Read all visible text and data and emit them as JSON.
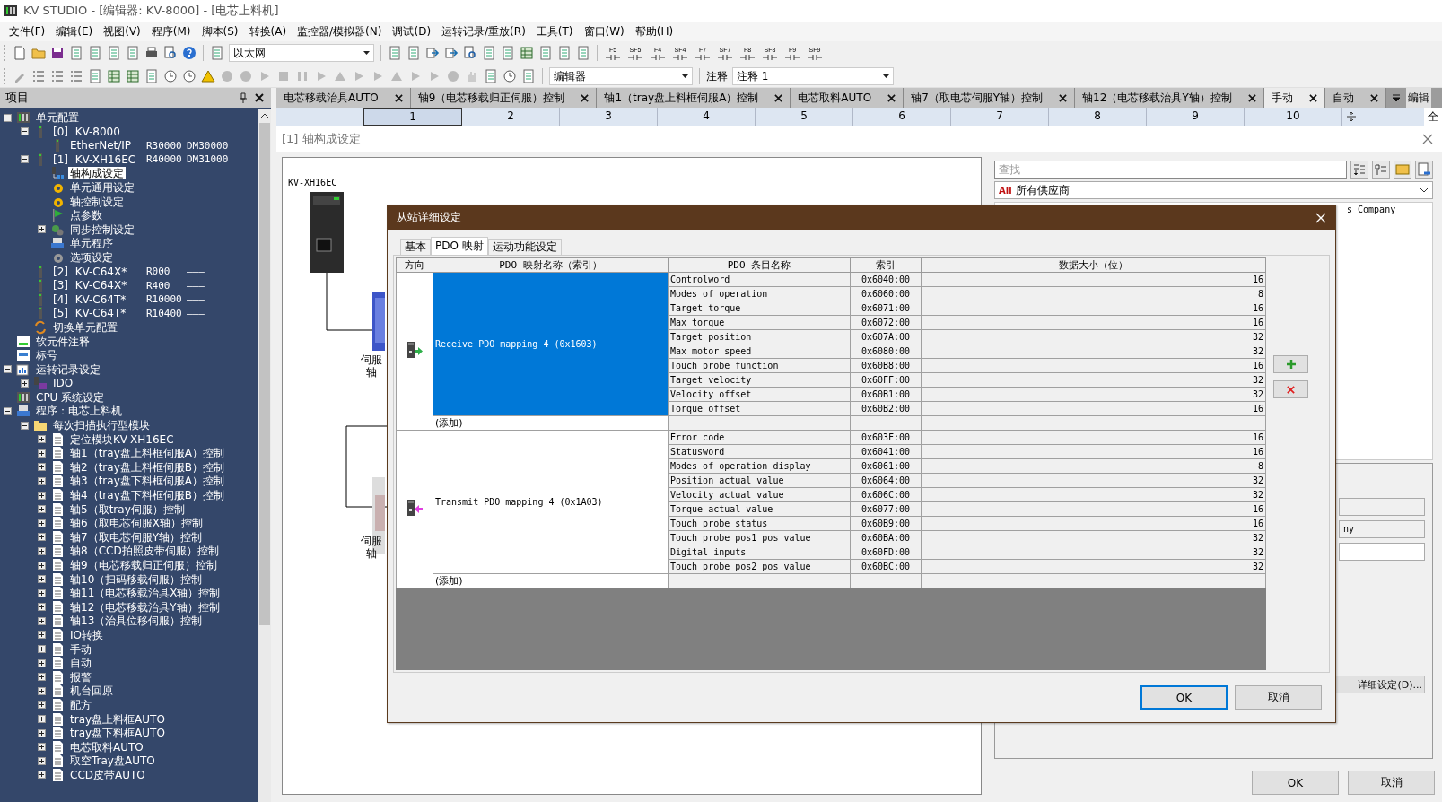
{
  "window": {
    "title": "KV STUDIO - [编辑器: KV-8000] - [电芯上料机]"
  },
  "menu": [
    "文件(F)",
    "编辑(E)",
    "视图(V)",
    "程序(M)",
    "脚本(S)",
    "转换(A)",
    "监控器/模拟器(N)",
    "调试(D)",
    "运转记录/重放(R)",
    "工具(T)",
    "窗口(W)",
    "帮助(H)"
  ],
  "toolbar_1": {
    "connection": "以太网",
    "function_keys": [
      "F5",
      "SF5",
      "F4",
      "SF4",
      "F7",
      "SF7",
      "F8",
      "SF8",
      "F9",
      "SF9"
    ]
  },
  "toolbar_2": {
    "view": "编辑器",
    "comment_label": "注释",
    "comment": "注释 1"
  },
  "project_panel": {
    "title": "项目",
    "tree": [
      {
        "label": "单元配置",
        "kind": "unit",
        "selected": false,
        "expanded": true,
        "children": [
          {
            "label": "[0]  KV-8000",
            "kind": "module",
            "selected": false,
            "expanded": true,
            "children": [
              {
                "label": "EtherNet/IP",
                "kind": "module",
                "selected": false,
                "cols": [
                  "R30000",
                  "DM30000"
                ]
              }
            ]
          },
          {
            "label": "[1]  KV-XH16EC",
            "kind": "module",
            "selected": false,
            "expanded": true,
            "cols": [
              "R40000",
              "DM31000"
            ],
            "children": [
              {
                "label": "轴构成设定",
                "kind": "network",
                "selected": true
              },
              {
                "label": "单元通用设定",
                "kind": "gear",
                "selected": false
              },
              {
                "label": "轴控制设定",
                "kind": "gear",
                "selected": false
              },
              {
                "label": "点参数",
                "kind": "flag",
                "selected": false
              },
              {
                "label": "同步控制设定",
                "kind": "gears",
                "selected": false,
                "expanded": false
              },
              {
                "label": "单元程序",
                "kind": "stack",
                "selected": false
              },
              {
                "label": "选项设定",
                "kind": "option",
                "selected": false
              }
            ]
          },
          {
            "label": "[2]  KV-C64X*",
            "kind": "module",
            "selected": false,
            "cols": [
              "R000",
              "———"
            ]
          },
          {
            "label": "[3]  KV-C64X*",
            "kind": "module",
            "selected": false,
            "cols": [
              "R400",
              "———"
            ]
          },
          {
            "label": "[4]  KV-C64T*",
            "kind": "module",
            "selected": false,
            "cols": [
              "R10000",
              "———"
            ]
          },
          {
            "label": "[5]  KV-C64T*",
            "kind": "module",
            "selected": false,
            "cols": [
              "R10400",
              "———"
            ]
          },
          {
            "label": "切换单元配置",
            "kind": "swap",
            "selected": false
          }
        ]
      },
      {
        "label": "软元件注释",
        "kind": "comment",
        "selected": false
      },
      {
        "label": "标号",
        "kind": "tag",
        "selected": false
      },
      {
        "label": "运转记录设定",
        "kind": "log",
        "selected": false,
        "expanded": true,
        "children": [
          {
            "label": "IDO",
            "kind": "disk",
            "selected": false,
            "expanded": false
          }
        ]
      },
      {
        "label": "CPU 系统设定",
        "kind": "unit",
        "selected": false
      },
      {
        "label": "程序：电芯上料机",
        "kind": "stack",
        "selected": false,
        "expanded": true,
        "children": [
          {
            "label": "每次扫描执行型模块",
            "kind": "folder",
            "selected": false,
            "expanded": true,
            "children": [
              {
                "label": "定位模块KV-XH16EC",
                "kind": "ladder",
                "selected": false,
                "expanded": false
              },
              {
                "label": "轴1（tray盘上料框伺服A）控制",
                "kind": "ladder",
                "selected": false,
                "expanded": false
              },
              {
                "label": "轴2（tray盘上料框伺服B）控制",
                "kind": "ladder",
                "selected": false,
                "expanded": false
              },
              {
                "label": "轴3（tray盘下料框伺服A）控制",
                "kind": "ladder",
                "selected": false,
                "expanded": false
              },
              {
                "label": "轴4（tray盘下料框伺服B）控制",
                "kind": "ladder",
                "selected": false,
                "expanded": false
              },
              {
                "label": "轴5（取tray伺服）控制",
                "kind": "ladder",
                "selected": false,
                "expanded": false
              },
              {
                "label": "轴6（取电芯伺服X轴）控制",
                "kind": "ladder",
                "selected": false,
                "expanded": false
              },
              {
                "label": "轴7（取电芯伺服Y轴）控制",
                "kind": "ladder",
                "selected": false,
                "expanded": false
              },
              {
                "label": "轴8（CCD拍照皮带伺服）控制",
                "kind": "ladder",
                "selected": false,
                "expanded": false
              },
              {
                "label": "轴9（电芯移载归正伺服）控制",
                "kind": "ladder",
                "selected": false,
                "expanded": false
              },
              {
                "label": "轴10（扫码移载伺服）控制",
                "kind": "ladder",
                "selected": false,
                "expanded": false
              },
              {
                "label": "轴11（电芯移载治具X轴）控制",
                "kind": "ladder",
                "selected": false,
                "expanded": false
              },
              {
                "label": "轴12（电芯移载治具Y轴）控制",
                "kind": "ladder",
                "selected": false,
                "expanded": false
              },
              {
                "label": "轴13（治具位移伺服）控制",
                "kind": "ladder",
                "selected": false,
                "expanded": false
              },
              {
                "label": "IO转换",
                "kind": "ladder",
                "selected": false,
                "expanded": false
              },
              {
                "label": "手动",
                "kind": "ladder",
                "selected": false,
                "expanded": false
              },
              {
                "label": "自动",
                "kind": "ladder",
                "selected": false,
                "expanded": false
              },
              {
                "label": "报警",
                "kind": "ladder",
                "selected": false,
                "expanded": false
              },
              {
                "label": "机台回原",
                "kind": "ladder",
                "selected": false,
                "expanded": false
              },
              {
                "label": "配方",
                "kind": "ladder",
                "selected": false,
                "expanded": false
              },
              {
                "label": "tray盘上料框AUTO",
                "kind": "ladder",
                "selected": false,
                "expanded": false
              },
              {
                "label": "tray盘下料框AUTO",
                "kind": "ladder",
                "selected": false,
                "expanded": false
              },
              {
                "label": "电芯取料AUTO",
                "kind": "ladder",
                "selected": false,
                "expanded": false
              },
              {
                "label": "取空Tray盘AUTO",
                "kind": "ladder",
                "selected": false,
                "expanded": false
              },
              {
                "label": "CCD皮带AUTO",
                "kind": "ladder",
                "selected": false,
                "expanded": false
              }
            ]
          }
        ]
      }
    ]
  },
  "document_tabs": [
    {
      "label": "电芯移载治具AUTO",
      "selected": false
    },
    {
      "label": "轴9（电芯移载归正伺服）控制",
      "selected": false
    },
    {
      "label": "轴1（tray盘上料框伺服A）控制",
      "selected": false
    },
    {
      "label": "电芯取料AUTO",
      "selected": false
    },
    {
      "label": "轴7（取电芯伺服Y轴）控制",
      "selected": false
    },
    {
      "label": "轴12（电芯移载治具Y轴）控制",
      "selected": false
    },
    {
      "label": "手动",
      "selected": true
    },
    {
      "label": "自动",
      "selected": false
    }
  ],
  "side_panel": {
    "title": "编辑",
    "item": "全"
  },
  "ruler": [
    {
      "label": "1",
      "selected": true
    },
    {
      "label": "2",
      "selected": false
    },
    {
      "label": "3",
      "selected": false
    },
    {
      "label": "4",
      "selected": false
    },
    {
      "label": "5",
      "selected": false
    },
    {
      "label": "6",
      "selected": false
    },
    {
      "label": "7",
      "selected": false
    },
    {
      "label": "8",
      "selected": false
    },
    {
      "label": "9",
      "selected": false
    },
    {
      "label": "10",
      "selected": false
    }
  ],
  "config_window": {
    "title": "[1] 轴构成设定",
    "unit_label": "KV-XH16EC",
    "servo_labels": [
      "伺服轴",
      "伺服轴"
    ],
    "search": {
      "placeholder": "查找"
    },
    "vendor_badge": "All",
    "vendor_filter": "所有供应商",
    "vendor_list": [
      "s Company"
    ],
    "fields": [
      {
        "kind": "readonly"
      },
      {
        "kind": "readonly",
        "value": "ny"
      },
      {
        "kind": "editable"
      }
    ],
    "detail_button": "详细设定(D)...",
    "buttons": [
      "OK",
      "取消"
    ]
  },
  "dialog": {
    "title": "从站详细设定",
    "tabs": [
      {
        "label": "基本",
        "selected": false
      },
      {
        "label": "PDO 映射",
        "selected": true
      },
      {
        "label": "运动功能设定",
        "selected": false
      }
    ],
    "columns": [
      "方向",
      "PDO 映射名称（索引）",
      "PDO 条目名称",
      "索引",
      "数据大小（位）"
    ],
    "groups": [
      {
        "kind": "receive",
        "name": "Receive PDO mapping 4 (0x1603)",
        "selected": true,
        "add_label": "(添加)",
        "entries": [
          {
            "name": "Controlword",
            "index": "0x6040:00",
            "size": "16"
          },
          {
            "name": "Modes of operation",
            "index": "0x6060:00",
            "size": "8"
          },
          {
            "name": "Target torque",
            "index": "0x6071:00",
            "size": "16"
          },
          {
            "name": "Max torque",
            "index": "0x6072:00",
            "size": "16"
          },
          {
            "name": "Target position",
            "index": "0x607A:00",
            "size": "32"
          },
          {
            "name": "Max motor speed",
            "index": "0x6080:00",
            "size": "32"
          },
          {
            "name": "Touch probe function",
            "index": "0x60B8:00",
            "size": "16"
          },
          {
            "name": "Target velocity",
            "index": "0x60FF:00",
            "size": "32"
          },
          {
            "name": "Velocity offset",
            "index": "0x60B1:00",
            "size": "32"
          },
          {
            "name": "Torque offset",
            "index": "0x60B2:00",
            "size": "16"
          }
        ]
      },
      {
        "kind": "transmit",
        "name": "Transmit PDO mapping 4 (0x1A03)",
        "selected": false,
        "add_label": "(添加)",
        "entries": [
          {
            "name": "Error code",
            "index": "0x603F:00",
            "size": "16"
          },
          {
            "name": "Statusword",
            "index": "0x6041:00",
            "size": "16"
          },
          {
            "name": "Modes of operation display",
            "index": "0x6061:00",
            "size": "8"
          },
          {
            "name": "Position actual value",
            "index": "0x6064:00",
            "size": "32"
          },
          {
            "name": "Velocity actual value",
            "index": "0x606C:00",
            "size": "32"
          },
          {
            "name": "Torque actual value",
            "index": "0x6077:00",
            "size": "16"
          },
          {
            "name": "Touch probe status",
            "index": "0x60B9:00",
            "size": "16"
          },
          {
            "name": "Touch probe pos1 pos value",
            "index": "0x60BA:00",
            "size": "32"
          },
          {
            "name": "Digital inputs",
            "index": "0x60FD:00",
            "size": "32"
          },
          {
            "name": "Touch probe pos2 pos value",
            "index": "0x60BC:00",
            "size": "32"
          }
        ]
      }
    ],
    "buttons": [
      {
        "label": "OK",
        "default": true
      },
      {
        "label": "取消",
        "default": false
      }
    ]
  }
}
